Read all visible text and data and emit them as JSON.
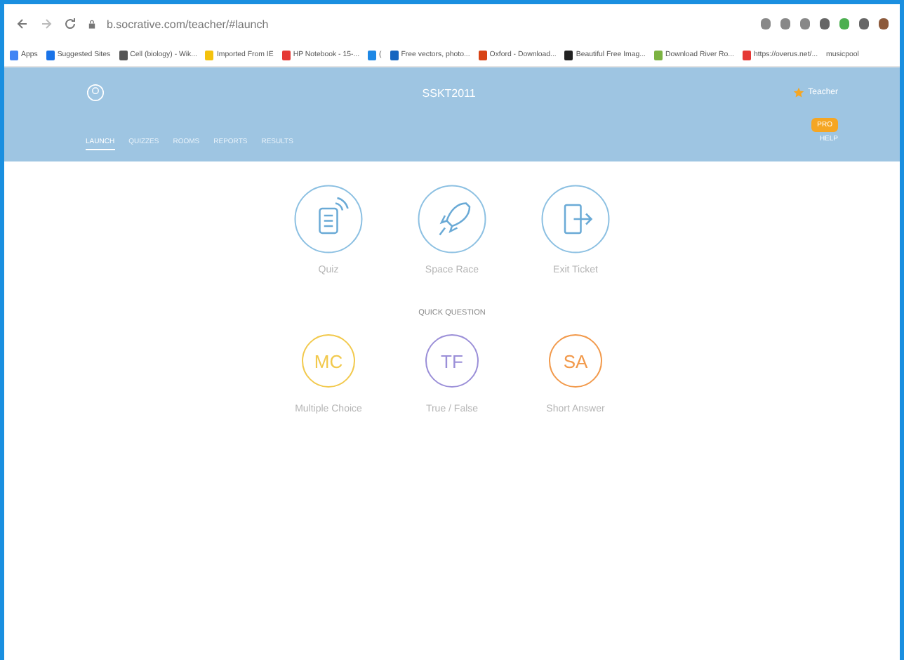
{
  "browser": {
    "url": "b.socrative.com/teacher/#launch"
  },
  "bookmarks": [
    {
      "label": "Apps",
      "color": "#4285f4"
    },
    {
      "label": "Suggested Sites",
      "color": "#1a73e8"
    },
    {
      "label": "Cell (biology) - Wik...",
      "color": "#555555"
    },
    {
      "label": "Imported From IE",
      "color": "#f4c20d"
    },
    {
      "label": "HP Notebook - 15-...",
      "color": "#e53935"
    },
    {
      "label": "(",
      "color": "#1e88e5"
    },
    {
      "label": "Free vectors, photo...",
      "color": "#1565c0"
    },
    {
      "label": "Oxford - Download...",
      "color": "#d84315"
    },
    {
      "label": "Beautiful Free Imag...",
      "color": "#222222"
    },
    {
      "label": "Download River Ro...",
      "color": "#7cb342"
    },
    {
      "label": "https://overus.net/...",
      "color": "#e53935"
    },
    {
      "label": "musicpool"
    }
  ],
  "header": {
    "room": "SSKT2011",
    "user": "Teacher",
    "badge": "PRO",
    "help": "HELP",
    "tabs": [
      {
        "label": "LAUNCH",
        "selected": true
      },
      {
        "label": "QUIZZES",
        "selected": false
      },
      {
        "label": "ROOMS",
        "selected": false
      },
      {
        "label": "REPORTS",
        "selected": false
      },
      {
        "label": "RESULTS",
        "selected": false
      }
    ]
  },
  "activities": [
    {
      "label": "Quiz",
      "kind": "quiz"
    },
    {
      "label": "Space Race",
      "kind": "rocket"
    },
    {
      "label": "Exit Ticket",
      "kind": "exit"
    }
  ],
  "quick_question": {
    "title": "QUICK QUESTION",
    "items": [
      {
        "abbr": "MC",
        "label": "Multiple Choice",
        "color": "#f2c94c"
      },
      {
        "abbr": "TF",
        "label": "True / False",
        "color": "#9b8fd8"
      },
      {
        "abbr": "SA",
        "label": "Short Answer",
        "color": "#f2994a"
      }
    ]
  }
}
